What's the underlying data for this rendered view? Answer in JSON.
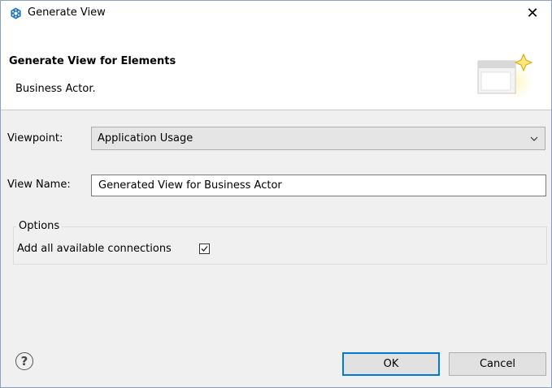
{
  "window": {
    "title": "Generate View",
    "close_glyph": "✕"
  },
  "banner": {
    "title": "Generate View for Elements",
    "description": "Business Actor."
  },
  "form": {
    "viewpoint_label": "Viewpoint:",
    "viewpoint_value": "Application Usage",
    "view_name_label": "View Name:",
    "view_name_value": "Generated View for Business Actor"
  },
  "options": {
    "group_label": "Options",
    "add_connections_label": "Add all available connections",
    "add_connections_checked": true
  },
  "buttons": {
    "help_glyph": "?",
    "ok": "OK",
    "cancel": "Cancel"
  },
  "colors": {
    "app_icon": "#1e73be",
    "ok_border": "#0078d7"
  },
  "icons": {
    "app": "app-logo-icon",
    "banner": "wizard-banner-icon",
    "combo_arrow": "chevron-down-icon",
    "check": "checkmark-icon",
    "help": "help-icon"
  }
}
